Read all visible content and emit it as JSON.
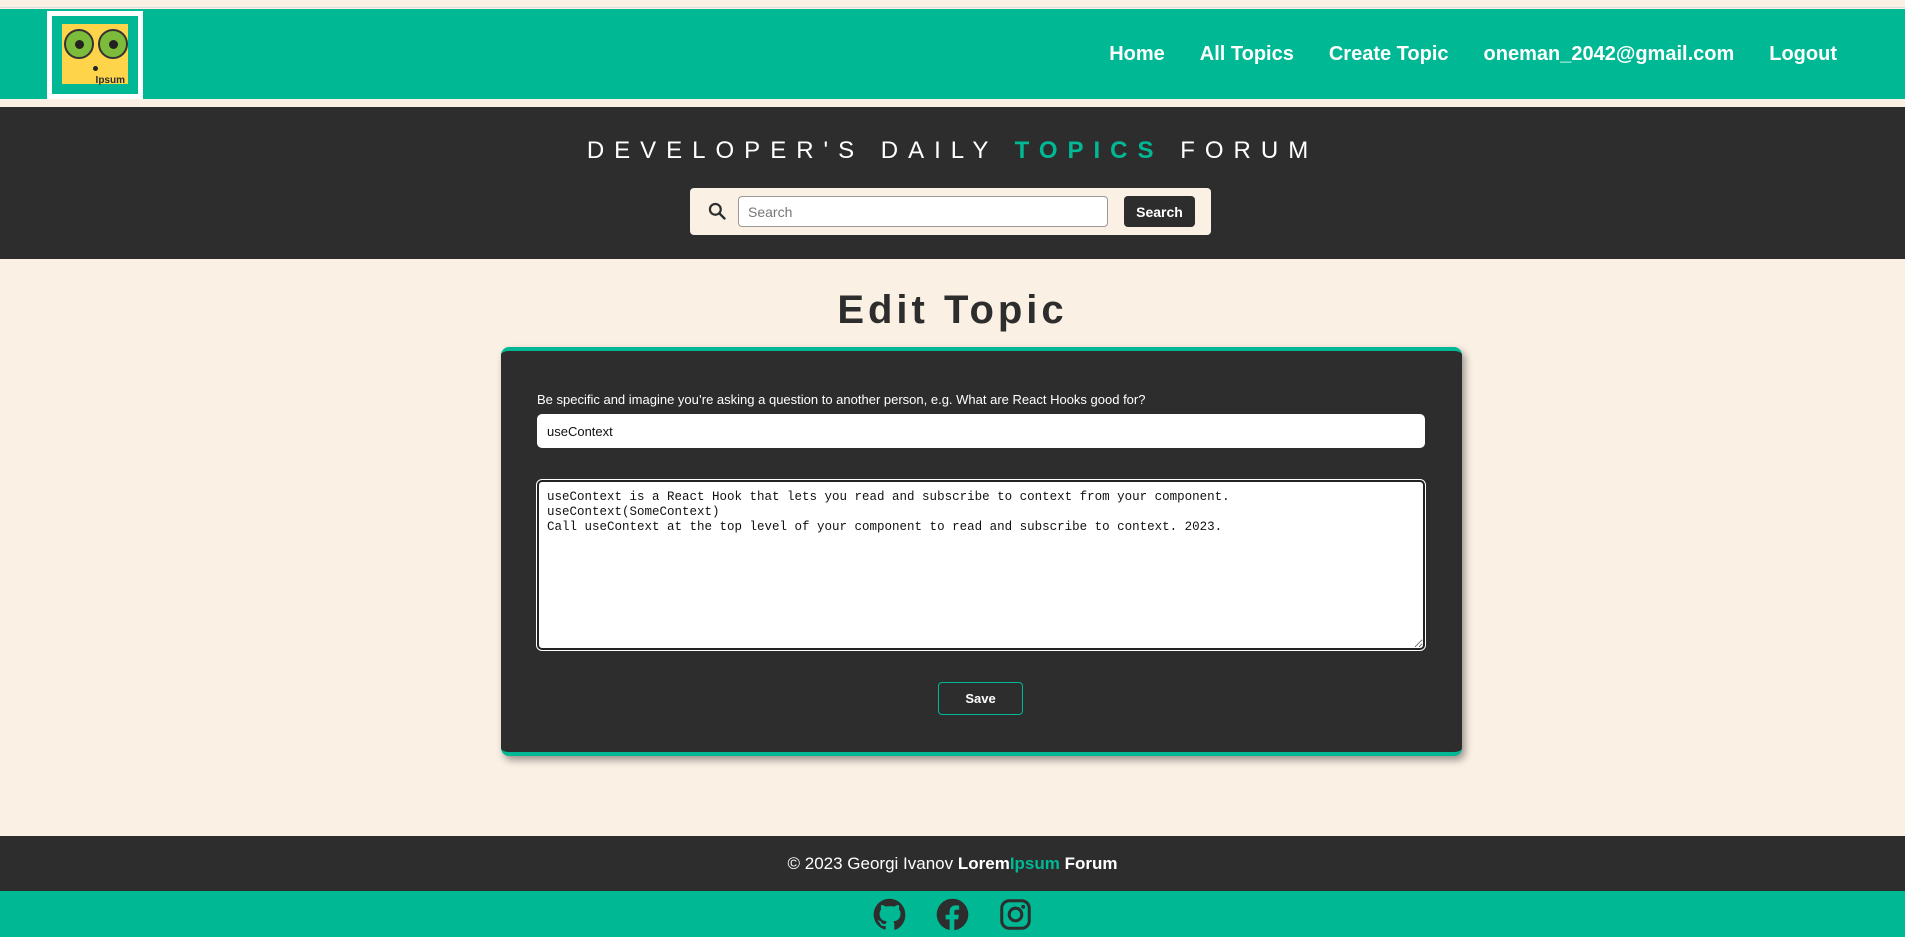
{
  "logo": {
    "text_a": "Lorem",
    "text_b": "Ipsum"
  },
  "nav": {
    "items": [
      {
        "label": "Home"
      },
      {
        "label": "All Topics"
      },
      {
        "label": "Create Topic"
      },
      {
        "label": "oneman_2042@gmail.com"
      },
      {
        "label": "Logout"
      }
    ]
  },
  "hero": {
    "title_part1": "DEVELOPER'S DAILY",
    "title_accent": "TOPICS",
    "title_part2": "FORUM",
    "search_placeholder": "Search",
    "search_button": "Search",
    "search_icon": "search-icon"
  },
  "main": {
    "page_title": "Edit Topic",
    "label": "Be specific and imagine you’re asking a question to another person, e.g. What are React Hooks good for?",
    "title_value": "useContext",
    "content_value": "useContext is a React Hook that lets you read and subscribe to context from your component.\nuseContext(SomeContext)\nCall useContext at the top level of your component to read and subscribe to context. 2023.",
    "save_label": "Save"
  },
  "footer": {
    "copyright": "© 2023 Georgi Ivanov",
    "brand_a": "Lorem",
    "brand_b": "Ipsum",
    "brand_c": "Forum"
  },
  "social": [
    "github-icon",
    "facebook-icon",
    "instagram-icon"
  ],
  "colors": {
    "accent": "#00b894",
    "dark": "#2d2d2d",
    "background": "#faf0e4"
  }
}
